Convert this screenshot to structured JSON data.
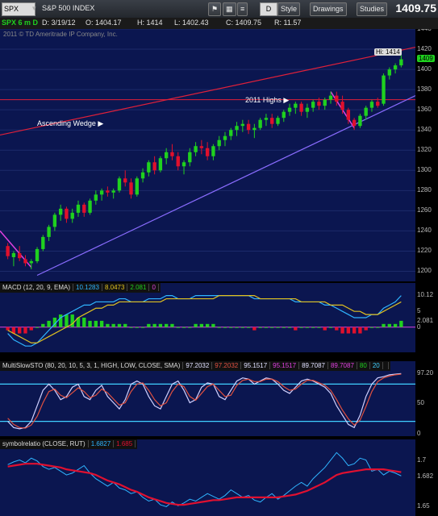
{
  "toolbar": {
    "symbol": "SPX",
    "index_name": "S&P 500 INDEX",
    "last_price_large": "1409.75",
    "buttons": [
      "D",
      "Style",
      "Drawings",
      "Studies"
    ]
  },
  "info": {
    "chart_id": "SPX 6 m D",
    "date": "D: 3/19/12",
    "open": "O: 1404.17",
    "high": "H: 1414",
    "low": "L: 1402.43",
    "close": "C: 1409.75",
    "range": "R: 11.57",
    "copyright": "2011 © TD Ameritrade IP Company, Inc."
  },
  "colors": {
    "background": "#0b1650",
    "up_candle": "#1fd11f",
    "down_candle": "#e0102c",
    "resistance": "#e0203a",
    "support": "#8a6cff",
    "macd_line": "#2fb4ff",
    "signal_line": "#e0c020",
    "sto_k": "#d0d0ff",
    "sto_d": "#e05040",
    "sto_bands": "#40d0ff",
    "ratio_line": "#2fb4ff",
    "ratio_ma": "#e01030"
  },
  "annotations": {
    "wedge": "Ascending Wedge",
    "highs": "2011 Highs",
    "hi_tag": "Hi: 1414",
    "last_tag": "1409"
  },
  "chart_data": [
    {
      "type": "candlestick",
      "panel": "price",
      "ylim": [
        1190,
        1440
      ],
      "yticks": [
        1200,
        1220,
        1240,
        1260,
        1280,
        1300,
        1320,
        1340,
        1360,
        1380,
        1400,
        1420,
        1440
      ],
      "ohlc": [
        [
          1225,
          1228,
          1212,
          1215
        ],
        [
          1214,
          1220,
          1205,
          1218
        ],
        [
          1218,
          1225,
          1210,
          1213
        ],
        [
          1212,
          1216,
          1205,
          1208
        ],
        [
          1208,
          1212,
          1202,
          1210
        ],
        [
          1210,
          1224,
          1208,
          1222
        ],
        [
          1222,
          1236,
          1220,
          1234
        ],
        [
          1234,
          1246,
          1230,
          1244
        ],
        [
          1244,
          1258,
          1240,
          1256
        ],
        [
          1256,
          1266,
          1250,
          1262
        ],
        [
          1262,
          1264,
          1248,
          1252
        ],
        [
          1252,
          1262,
          1248,
          1258
        ],
        [
          1258,
          1270,
          1254,
          1266
        ],
        [
          1266,
          1268,
          1254,
          1258
        ],
        [
          1258,
          1272,
          1256,
          1270
        ],
        [
          1270,
          1280,
          1266,
          1276
        ],
        [
          1276,
          1282,
          1270,
          1280
        ],
        [
          1280,
          1284,
          1274,
          1278
        ],
        [
          1278,
          1282,
          1272,
          1280
        ],
        [
          1280,
          1294,
          1278,
          1292
        ],
        [
          1292,
          1300,
          1284,
          1288
        ],
        [
          1288,
          1292,
          1272,
          1276
        ],
        [
          1276,
          1294,
          1274,
          1292
        ],
        [
          1292,
          1302,
          1288,
          1298
        ],
        [
          1298,
          1310,
          1294,
          1308
        ],
        [
          1308,
          1314,
          1296,
          1300
        ],
        [
          1300,
          1314,
          1298,
          1312
        ],
        [
          1312,
          1322,
          1306,
          1318
        ],
        [
          1318,
          1326,
          1310,
          1314
        ],
        [
          1314,
          1318,
          1300,
          1304
        ],
        [
          1304,
          1310,
          1296,
          1308
        ],
        [
          1308,
          1322,
          1304,
          1318
        ],
        [
          1318,
          1328,
          1314,
          1324
        ],
        [
          1324,
          1330,
          1316,
          1322
        ],
        [
          1322,
          1328,
          1310,
          1314
        ],
        [
          1314,
          1326,
          1310,
          1324
        ],
        [
          1324,
          1334,
          1320,
          1330
        ],
        [
          1330,
          1338,
          1324,
          1334
        ],
        [
          1334,
          1342,
          1330,
          1340
        ],
        [
          1340,
          1348,
          1334,
          1344
        ],
        [
          1344,
          1350,
          1338,
          1346
        ],
        [
          1346,
          1350,
          1336,
          1340
        ],
        [
          1340,
          1346,
          1332,
          1342
        ],
        [
          1342,
          1352,
          1340,
          1350
        ],
        [
          1350,
          1356,
          1344,
          1352
        ],
        [
          1352,
          1356,
          1342,
          1346
        ],
        [
          1346,
          1354,
          1344,
          1352
        ],
        [
          1352,
          1360,
          1348,
          1358
        ],
        [
          1358,
          1366,
          1354,
          1362
        ],
        [
          1362,
          1368,
          1356,
          1366
        ],
        [
          1366,
          1368,
          1354,
          1358
        ],
        [
          1358,
          1366,
          1352,
          1362
        ],
        [
          1362,
          1370,
          1358,
          1368
        ],
        [
          1368,
          1372,
          1360,
          1364
        ],
        [
          1364,
          1372,
          1360,
          1370
        ],
        [
          1370,
          1378,
          1366,
          1374
        ],
        [
          1374,
          1378,
          1364,
          1368
        ],
        [
          1368,
          1374,
          1356,
          1360
        ],
        [
          1360,
          1362,
          1346,
          1350
        ],
        [
          1350,
          1352,
          1340,
          1344
        ],
        [
          1344,
          1356,
          1342,
          1354
        ],
        [
          1354,
          1364,
          1350,
          1362
        ],
        [
          1362,
          1370,
          1358,
          1368
        ],
        [
          1368,
          1372,
          1362,
          1364
        ],
        [
          1366,
          1396,
          1364,
          1394
        ],
        [
          1394,
          1402,
          1390,
          1400
        ],
        [
          1400,
          1406,
          1396,
          1404
        ],
        [
          1404,
          1414,
          1402,
          1410
        ]
      ]
    },
    {
      "type": "line",
      "panel": "macd",
      "title_parts": [
        "MACD (12, 20, 9, EMA)",
        "10.1283",
        "8.0473",
        "2.081",
        "0"
      ],
      "ylim": [
        -8,
        14
      ],
      "yticks": [
        10.12,
        5,
        2.081,
        0
      ],
      "ytick_labels": [
        "10.12",
        "5",
        "2.081",
        "0"
      ],
      "series": [
        {
          "name": "MACD",
          "values": [
            -2,
            -4,
            -5,
            -6,
            -6,
            -5,
            -3,
            -1,
            1,
            3,
            4,
            5,
            6,
            7,
            7,
            8,
            8,
            8,
            8,
            9,
            9,
            8,
            8,
            8,
            9,
            9,
            9,
            10,
            10,
            9,
            9,
            9,
            10,
            10,
            10,
            10,
            10,
            10,
            10,
            10,
            10,
            10,
            9,
            9,
            9,
            9,
            9,
            9,
            9,
            8,
            8,
            8,
            8,
            8,
            7,
            7,
            6,
            5,
            4,
            3,
            3,
            3,
            4,
            4,
            6,
            7,
            8,
            10
          ]
        },
        {
          "name": "Signal",
          "values": [
            -1,
            -2,
            -3,
            -4,
            -5,
            -5,
            -4,
            -3,
            -2,
            -1,
            0,
            1,
            3,
            4,
            5,
            6,
            6,
            7,
            7,
            8,
            8,
            8,
            8,
            8,
            8,
            8,
            8,
            9,
            9,
            9,
            9,
            9,
            9,
            9,
            9,
            9,
            10,
            10,
            10,
            10,
            10,
            10,
            10,
            9,
            9,
            9,
            9,
            9,
            9,
            9,
            8,
            8,
            8,
            8,
            8,
            7,
            7,
            7,
            6,
            5,
            5,
            4,
            4,
            4,
            5,
            6,
            7,
            8
          ]
        }
      ],
      "histogram": [
        -1,
        -2,
        -2,
        -2,
        -1,
        0,
        1,
        2,
        3,
        4,
        4,
        4,
        3,
        3,
        2,
        2,
        2,
        1,
        1,
        1,
        1,
        0,
        0,
        0,
        1,
        1,
        1,
        1,
        1,
        0,
        0,
        0,
        1,
        1,
        1,
        1,
        0,
        0,
        0,
        0,
        0,
        0,
        -1,
        0,
        0,
        0,
        0,
        0,
        0,
        -1,
        0,
        0,
        0,
        0,
        -1,
        0,
        -1,
        -2,
        -2,
        -2,
        -2,
        -1,
        0,
        0,
        1,
        1,
        1,
        2
      ]
    },
    {
      "type": "line",
      "panel": "stochastic",
      "title_parts": [
        "MultiSlowSTO (80, 20, 10, 5, 3, 1, HIGH, LOW, CLOSE, SMA)",
        "97.2032",
        "97.2032",
        "95.1517",
        "95.1517",
        "89.7087",
        "89.7087",
        "80",
        "20"
      ],
      "ylim": [
        0,
        100
      ],
      "yticks": [
        97.2,
        50,
        0
      ],
      "ytick_labels": [
        "97.20",
        "50",
        "0"
      ],
      "bands": [
        80,
        20
      ],
      "series": [
        {
          "name": "K",
          "values": [
            20,
            10,
            8,
            10,
            20,
            45,
            70,
            80,
            70,
            55,
            60,
            75,
            80,
            60,
            55,
            70,
            78,
            60,
            50,
            40,
            55,
            80,
            85,
            80,
            60,
            45,
            40,
            60,
            80,
            85,
            70,
            50,
            55,
            75,
            82,
            80,
            60,
            55,
            70,
            85,
            90,
            88,
            80,
            85,
            90,
            88,
            80,
            70,
            65,
            75,
            85,
            88,
            85,
            80,
            75,
            65,
            45,
            30,
            15,
            10,
            30,
            60,
            80,
            90,
            92,
            95,
            96,
            97
          ]
        },
        {
          "name": "D",
          "values": [
            25,
            15,
            10,
            9,
            14,
            28,
            50,
            68,
            72,
            62,
            58,
            66,
            74,
            68,
            58,
            62,
            72,
            66,
            56,
            46,
            50,
            68,
            80,
            82,
            70,
            55,
            45,
            50,
            68,
            80,
            76,
            60,
            54,
            65,
            76,
            80,
            70,
            60,
            62,
            78,
            86,
            88,
            84,
            84,
            88,
            88,
            84,
            76,
            70,
            72,
            80,
            86,
            86,
            82,
            78,
            70,
            55,
            38,
            24,
            14,
            22,
            44,
            68,
            84,
            90,
            93,
            95,
            96
          ]
        }
      ]
    },
    {
      "type": "line",
      "panel": "ratio",
      "title_parts": [
        "symbolrelatio (CLOSE, RUT)",
        "1.6827",
        "1.685"
      ],
      "ylim": [
        1.64,
        1.71
      ],
      "yticks": [
        1.7,
        1.6827,
        1.65
      ],
      "ytick_labels": [
        "1.7",
        "1.682",
        "1.65"
      ],
      "series": [
        {
          "name": "Ratio",
          "values": [
            1.695,
            1.698,
            1.7,
            1.697,
            1.702,
            1.699,
            1.693,
            1.69,
            1.692,
            1.688,
            1.684,
            1.686,
            1.69,
            1.694,
            1.686,
            1.68,
            1.676,
            1.672,
            1.676,
            1.67,
            1.668,
            1.664,
            1.666,
            1.66,
            1.656,
            1.658,
            1.652,
            1.65,
            1.655,
            1.651,
            1.654,
            1.658,
            1.656,
            1.66,
            1.664,
            1.661,
            1.658,
            1.662,
            1.668,
            1.664,
            1.66,
            1.662,
            1.657,
            1.655,
            1.66,
            1.664,
            1.658,
            1.662,
            1.667,
            1.672,
            1.676,
            1.672,
            1.68,
            1.686,
            1.692,
            1.7,
            1.708,
            1.702,
            1.694,
            1.696,
            1.702,
            1.7,
            1.688,
            1.69,
            1.684,
            1.688,
            1.686,
            1.683
          ]
        },
        {
          "name": "MA",
          "values": [
            1.693,
            1.694,
            1.695,
            1.696,
            1.696,
            1.696,
            1.695,
            1.694,
            1.693,
            1.692,
            1.69,
            1.689,
            1.688,
            1.687,
            1.686,
            1.684,
            1.681,
            1.678,
            1.676,
            1.674,
            1.671,
            1.668,
            1.666,
            1.663,
            1.66,
            1.658,
            1.656,
            1.654,
            1.653,
            1.652,
            1.652,
            1.653,
            1.654,
            1.655,
            1.656,
            1.657,
            1.657,
            1.658,
            1.659,
            1.66,
            1.66,
            1.66,
            1.66,
            1.66,
            1.66,
            1.66,
            1.66,
            1.661,
            1.662,
            1.663,
            1.665,
            1.667,
            1.67,
            1.673,
            1.676,
            1.68,
            1.684,
            1.686,
            1.687,
            1.688,
            1.689,
            1.69,
            1.69,
            1.69,
            1.69,
            1.689,
            1.688,
            1.687
          ]
        }
      ]
    }
  ]
}
